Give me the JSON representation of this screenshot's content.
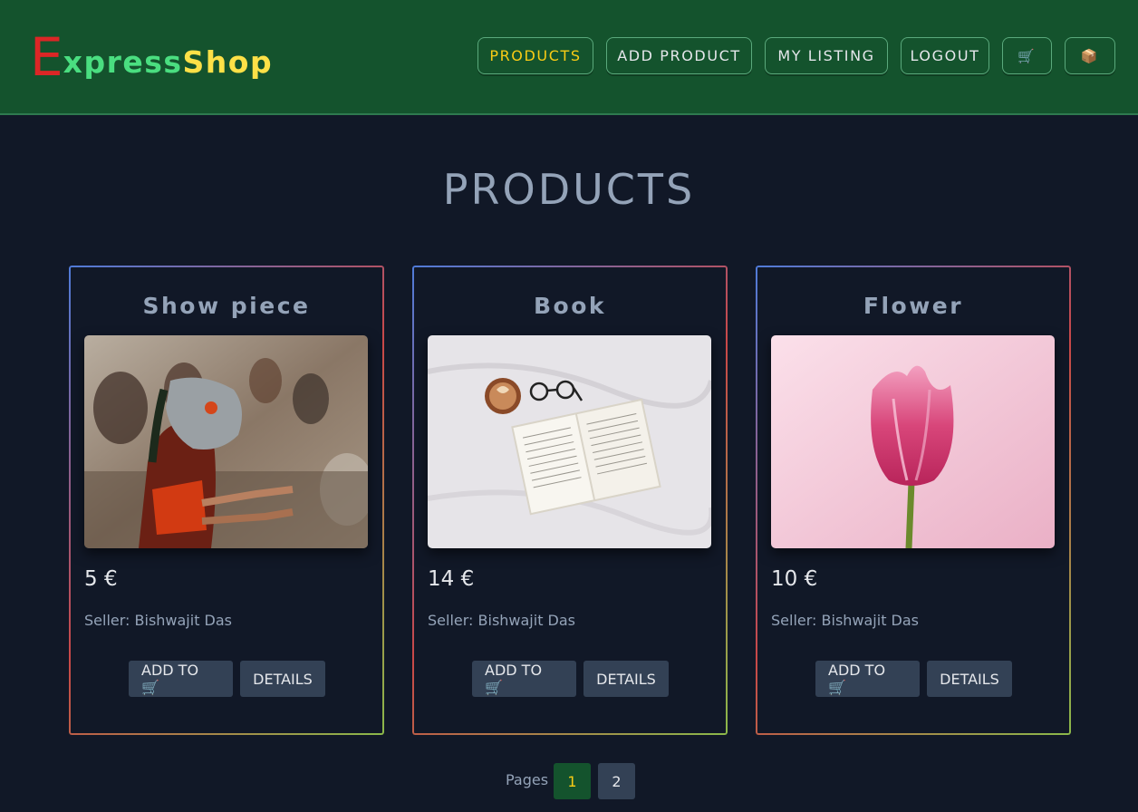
{
  "brand": {
    "first_letter": "E",
    "part_middle": "xpress",
    "part_end": "Shop"
  },
  "nav": {
    "products": "PRODUCTS",
    "add_product": "ADD PRODUCT",
    "my_listing": "MY LISTING",
    "logout": "LOGOUT",
    "cart_icon": "🛒",
    "package_icon": "📦"
  },
  "page_title": "PRODUCTS",
  "products": [
    {
      "title": "Show piece",
      "price": "5 €",
      "seller_label": "Seller:",
      "seller_name": "Bishwajit Das",
      "add_label": "ADD TO 🛒",
      "details_label": "DETAILS",
      "image": "masked-dancer-photo"
    },
    {
      "title": "Book",
      "price": "14 €",
      "seller_label": "Seller:",
      "seller_name": "Bishwajit Das",
      "add_label": "ADD TO 🛒",
      "details_label": "DETAILS",
      "image": "open-book-coffee-glasses-photo"
    },
    {
      "title": "Flower",
      "price": "10 €",
      "seller_label": "Seller:",
      "seller_name": "Bishwajit Das",
      "add_label": "ADD TO 🛒",
      "details_label": "DETAILS",
      "image": "pink-tulip-photo"
    }
  ],
  "pagination": {
    "label": "Pages",
    "pages": [
      "1",
      "2"
    ],
    "current": "1"
  },
  "colors": {
    "header": "#14532d",
    "background": "#111827",
    "accent": "#facc15",
    "button": "#334155"
  }
}
